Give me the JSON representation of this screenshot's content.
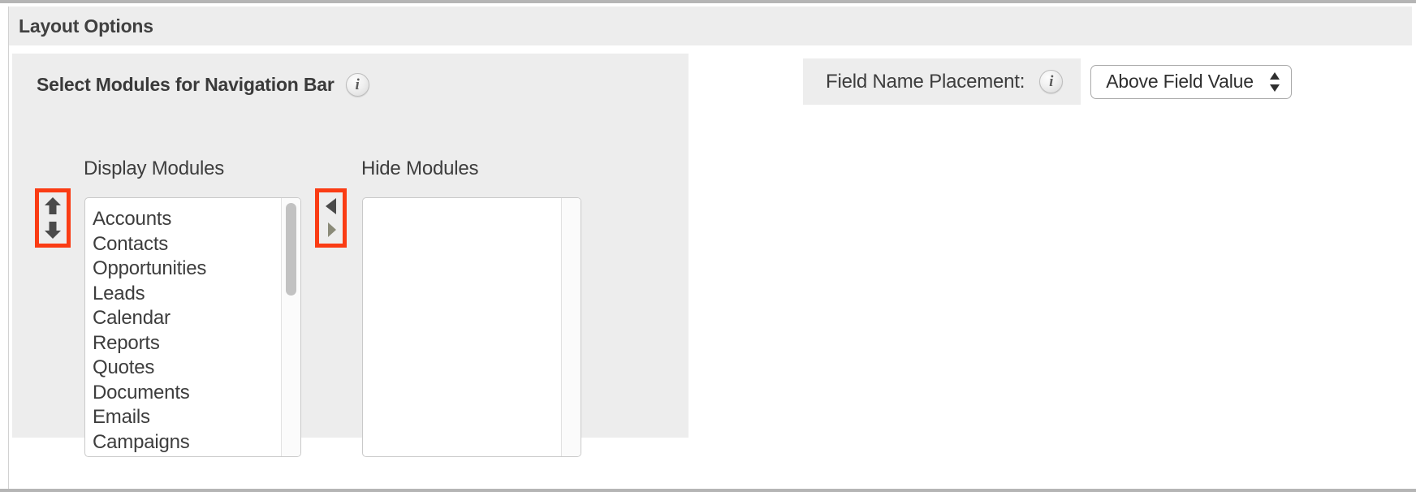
{
  "header": {
    "title": "Layout Options"
  },
  "modules_card": {
    "title": "Select Modules for Navigation Bar",
    "info_icon": "info-icon",
    "info_glyph": "i",
    "columns": {
      "display_label": "Display Modules",
      "hide_label": "Hide Modules"
    },
    "display_modules": [
      "Accounts",
      "Contacts",
      "Opportunities",
      "Leads",
      "Calendar",
      "Reports",
      "Quotes",
      "Documents",
      "Emails",
      "Campaigns"
    ],
    "hide_modules": [],
    "order_buttons": {
      "move_up": "arrow-up-icon",
      "move_down": "arrow-down-icon"
    },
    "transfer_buttons": {
      "move_left": "arrow-left-icon",
      "move_right": "arrow-right-icon"
    }
  },
  "field_name_placement": {
    "label": "Field Name Placement:",
    "info_icon": "info-icon",
    "info_glyph": "i",
    "selected_value": "Above Field Value",
    "stepper_icon": "stepper-updown-icon"
  },
  "colors": {
    "highlight": "#fa3c14",
    "panel_bg": "#ededed",
    "text": "#3d3d3d",
    "arrow_active": "#4a4a4a",
    "arrow_disabled": "#8a8a78",
    "scroll_thumb": "#c2c2c2"
  }
}
